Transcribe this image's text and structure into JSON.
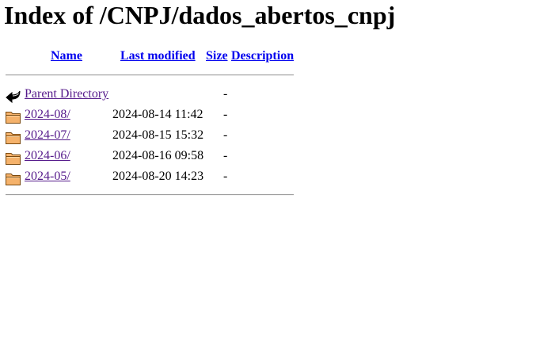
{
  "title": "Index of /CNPJ/dados_abertos_cnpj",
  "columns": {
    "name": "Name",
    "last_modified": "Last modified",
    "size": "Size",
    "description": "Description"
  },
  "parent": {
    "icon": "back-arrow-icon",
    "label": "Parent Directory",
    "size": "-"
  },
  "rows": [
    {
      "icon": "folder-icon",
      "name": "2024-08/",
      "modified": "2024-08-14 11:42",
      "size": "-"
    },
    {
      "icon": "folder-icon",
      "name": "2024-07/",
      "modified": "2024-08-15 15:32",
      "size": "-"
    },
    {
      "icon": "folder-icon",
      "name": "2024-06/",
      "modified": "2024-08-16 09:58",
      "size": "-"
    },
    {
      "icon": "folder-icon",
      "name": "2024-05/",
      "modified": "2024-08-20 14:23",
      "size": "-"
    }
  ],
  "colors": {
    "link": "#0000ee",
    "visited_link": "#551a8b",
    "folder_fill": "#f5b26b",
    "folder_stroke": "#7a4a10"
  }
}
